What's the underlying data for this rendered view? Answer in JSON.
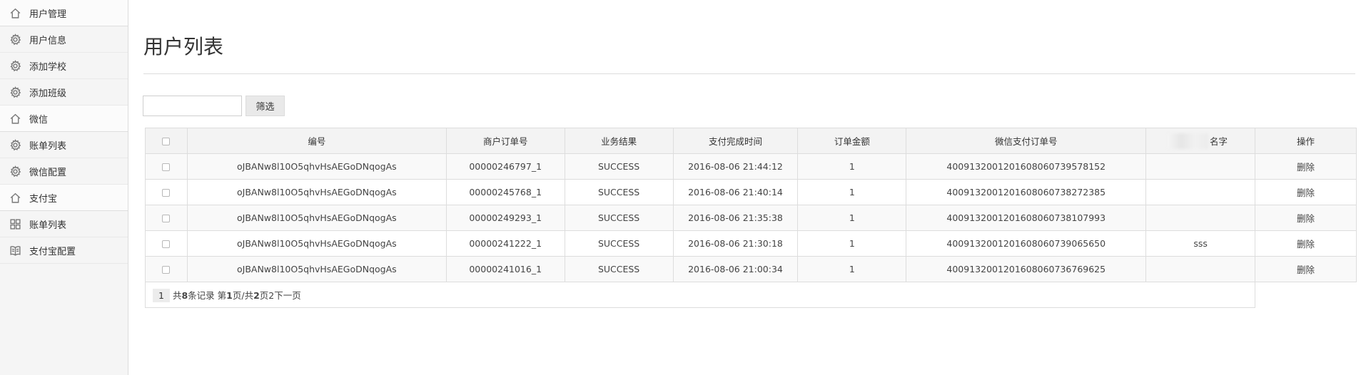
{
  "sidebar": {
    "items": [
      {
        "label": "用户管理",
        "icon": "home-icon",
        "group": true
      },
      {
        "label": "用户信息",
        "icon": "gear-icon",
        "group": false
      },
      {
        "label": "添加学校",
        "icon": "gear-icon",
        "group": false
      },
      {
        "label": "添加班级",
        "icon": "gear-icon",
        "group": false
      },
      {
        "label": "微信",
        "icon": "home-icon",
        "group": true
      },
      {
        "label": "账单列表",
        "icon": "gear-icon",
        "group": false
      },
      {
        "label": "微信配置",
        "icon": "gear-icon",
        "group": false
      },
      {
        "label": "支付宝",
        "icon": "home-icon",
        "group": true
      },
      {
        "label": "账单列表",
        "icon": "grid-icon",
        "group": false
      },
      {
        "label": "支付宝配置",
        "icon": "book-icon",
        "group": false
      }
    ]
  },
  "page": {
    "title": "用户列表"
  },
  "filter": {
    "value": "",
    "placeholder": "",
    "button_label": "筛选"
  },
  "table": {
    "headers": [
      "编号",
      "商户订单号",
      "业务结果",
      "支付完成时间",
      "订单金额",
      "微信支付订单号",
      "名字",
      "操作"
    ],
    "rows": [
      {
        "id": "oJBANw8l10O5qhvHsAEGoDNqogAs",
        "order": "00000246797_1",
        "result": "SUCCESS",
        "time": "2016-08-06 21:44:12",
        "amount": "1",
        "wx_order": "4009132001201608060739578152",
        "name": "",
        "action": "删除"
      },
      {
        "id": "oJBANw8l10O5qhvHsAEGoDNqogAs",
        "order": "00000245768_1",
        "result": "SUCCESS",
        "time": "2016-08-06 21:40:14",
        "amount": "1",
        "wx_order": "4009132001201608060738272385",
        "name": "",
        "action": "删除"
      },
      {
        "id": "oJBANw8l10O5qhvHsAEGoDNqogAs",
        "order": "00000249293_1",
        "result": "SUCCESS",
        "time": "2016-08-06 21:35:38",
        "amount": "1",
        "wx_order": "4009132001201608060738107993",
        "name": "",
        "action": "删除"
      },
      {
        "id": "oJBANw8l10O5qhvHsAEGoDNqogAs",
        "order": "00000241222_1",
        "result": "SUCCESS",
        "time": "2016-08-06 21:30:18",
        "amount": "1",
        "wx_order": "4009132001201608060739065650",
        "name": "sss",
        "action": "删除"
      },
      {
        "id": "oJBANw8l10O5qhvHsAEGoDNqogAs",
        "order": "00000241016_1",
        "result": "SUCCESS",
        "time": "2016-08-06 21:00:34",
        "amount": "1",
        "wx_order": "4009132001201608060736769625",
        "name": "",
        "action": "删除"
      }
    ]
  },
  "pager": {
    "current": "1",
    "text_a": "共",
    "total_records": "8",
    "text_b": "条记录 第",
    "page": "1",
    "text_c": "页/共",
    "pages": "2",
    "text_d": "页",
    "page_link": "2",
    "next_label": "下一页"
  }
}
